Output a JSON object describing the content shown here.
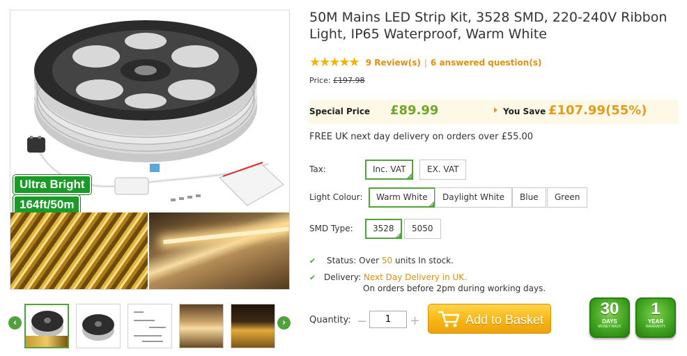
{
  "gallery": {
    "badges": [
      "Ultra Bright",
      "164ft/50m"
    ],
    "thumb_count": 5,
    "active_thumb": 1
  },
  "product": {
    "title": "50M Mains LED Strip Kit, 3528 SMD, 220-240V Ribbon Light, IP65 Waterproof, Warm White",
    "rating_stars": 5,
    "reviews_label": "9 Review(s)",
    "questions_label": "6 answered question(s)",
    "price_label": "Price:",
    "old_price": "£197.98",
    "special_label": "Special Price",
    "special_price": "£89.99",
    "save_label": "You Save",
    "save_value": "£107.99(55%)",
    "delivery_note": "FREE UK next day delivery on orders over £55.00"
  },
  "options": {
    "tax": {
      "label": "Tax:",
      "choices": [
        "Inc. VAT",
        "EX. VAT"
      ],
      "selected": 0
    },
    "colour": {
      "label": "Light Colour:",
      "choices": [
        "Warm White",
        "Daylight White",
        "Blue",
        "Green"
      ],
      "selected": 0
    },
    "smd": {
      "label": "SMD Type:",
      "choices": [
        "3528",
        "5050"
      ],
      "selected": 0
    }
  },
  "status": {
    "status_label": "Status:",
    "status_prefix": "Over",
    "status_count": "50",
    "status_suffix": "units In stock.",
    "delivery_label": "Delivery:",
    "delivery_value": "Next Day Delivery in UK.",
    "delivery_sub": "On orders before 2pm during working days."
  },
  "purchase": {
    "quantity_label": "Quantity:",
    "quantity_value": "1",
    "basket_label": "Add to Basket"
  },
  "guarantees": [
    {
      "big": "30",
      "mid": "DAYS",
      "small": "MONEY BACK"
    },
    {
      "big": "1",
      "mid": "YEAR",
      "small": "WARRANTY"
    }
  ],
  "colors": {
    "accent_green": "#4fa33a",
    "price_green": "#6ea52a",
    "orange": "#e0900c",
    "basket_yellow": "#f7b614"
  }
}
